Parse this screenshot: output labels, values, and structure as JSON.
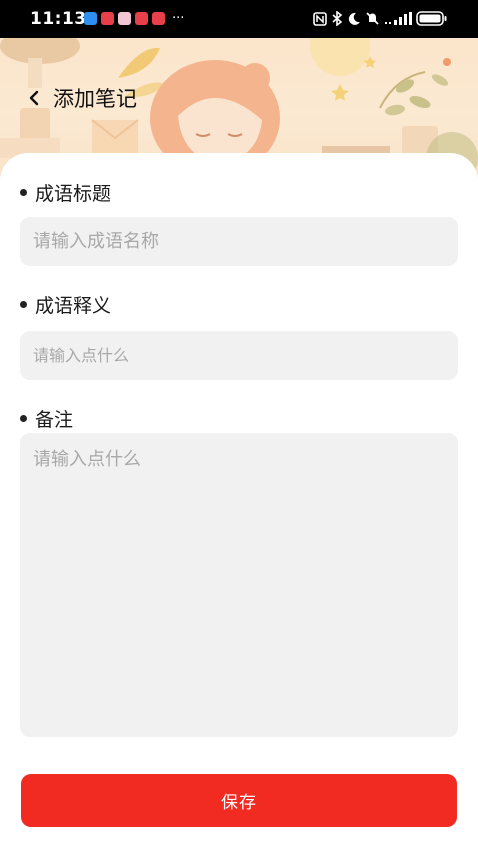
{
  "status_bar": {
    "time": "11:13",
    "more_indicator": "···",
    "notification_icon_colors": [
      "#2f8ff0",
      "#e8404a",
      "#f0c0d0",
      "#e8404a",
      "#e8404a"
    ]
  },
  "header": {
    "title": "添加笔记",
    "back_icon": "chevron-left-icon"
  },
  "form": {
    "title_label": "成语标题",
    "title_placeholder": "请输入成语名称",
    "meaning_label": "成语释义",
    "meaning_placeholder": "请输入点什么",
    "note_label": "备注",
    "note_placeholder": "请输入点什么",
    "save_label": "保存"
  },
  "colors": {
    "accent": "#f12a22",
    "input_background": "#f1f1f1",
    "header_background": "#fbe5cb"
  }
}
